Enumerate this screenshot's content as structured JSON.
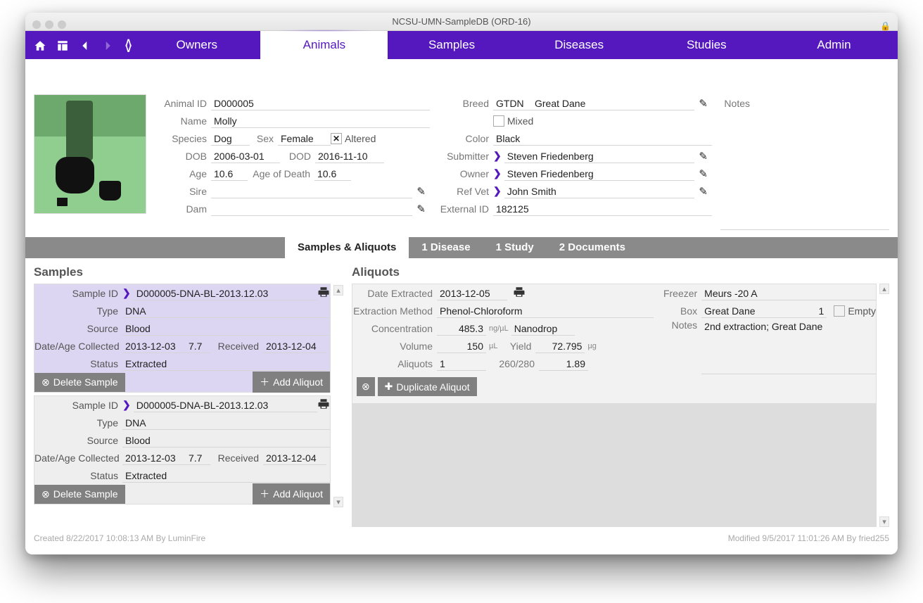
{
  "window": {
    "title": "NCSU-UMN-SampleDB (ORD-16)"
  },
  "nav": {
    "tabs": [
      "Owners",
      "Animals",
      "Samples",
      "Diseases",
      "Studies",
      "Admin"
    ],
    "active": "Animals"
  },
  "animal": {
    "id_label": "Animal ID",
    "id": "D000005",
    "name_label": "Name",
    "name": "Molly",
    "species_label": "Species",
    "species": "Dog",
    "sex_label": "Sex",
    "sex": "Female",
    "altered_label": "Altered",
    "altered": true,
    "dob_label": "DOB",
    "dob": "2006-03-01",
    "dod_label": "DOD",
    "dod": "2016-11-10",
    "age_label": "Age",
    "age": "10.6",
    "age_death_label": "Age of Death",
    "age_death": "10.6",
    "sire_label": "Sire",
    "sire": "",
    "dam_label": "Dam",
    "dam": "",
    "breed_label": "Breed",
    "breed_code": "GTDN",
    "breed_name": "Great Dane",
    "mixed_label": "Mixed",
    "mixed": false,
    "color_label": "Color",
    "color": "Black",
    "submitter_label": "Submitter",
    "submitter": "Steven Friedenberg",
    "owner_label": "Owner",
    "owner": "Steven Friedenberg",
    "refvet_label": "Ref Vet",
    "refvet": "John Smith",
    "externalid_label": "External ID",
    "externalid": "182125",
    "notes_label": "Notes"
  },
  "subtabs": {
    "items": [
      "Samples & Aliquots",
      "1 Disease",
      "1 Study",
      "2 Documents"
    ],
    "active": "Samples & Aliquots"
  },
  "samples": {
    "heading": "Samples",
    "labels": {
      "sample_id": "Sample ID",
      "type": "Type",
      "source": "Source",
      "dateage": "Date/Age Collected",
      "received_lbl": "Received",
      "status": "Status"
    },
    "btn_delete": "Delete Sample",
    "btn_add": "Add Aliquot",
    "items": [
      {
        "id": "D000005-DNA-BL-2013.12.03",
        "type": "DNA",
        "source": "Blood",
        "collected": "2013-12-03",
        "age": "7.7",
        "received": "2013-12-04",
        "status": "Extracted",
        "selected": true
      },
      {
        "id": "D000005-DNA-BL-2013.12.03",
        "type": "DNA",
        "source": "Blood",
        "collected": "2013-12-03",
        "age": "7.7",
        "received": "2013-12-04",
        "status": "Extracted",
        "selected": false
      }
    ]
  },
  "aliquots": {
    "heading": "Aliquots",
    "labels": {
      "date_extracted": "Date Extracted",
      "extraction_method": "Extraction Method",
      "concentration": "Concentration",
      "conc_unit": "ng/µL",
      "volume": "Volume",
      "vol_unit": "µL",
      "yield": "Yield",
      "yield_unit": "µg",
      "aliquots": "Aliquots",
      "ratio": "260/280",
      "freezer": "Freezer",
      "box": "Box",
      "empty": "Empty",
      "notes": "Notes"
    },
    "btn_dup": "Duplicate Aliquot",
    "item": {
      "date_extracted": "2013-12-05",
      "extraction_method": "Phenol-Chloroform",
      "concentration": "485.3",
      "conc_method": "Nanodrop",
      "volume": "150",
      "yield": "72.795",
      "aliquots": "1",
      "ratio": "1.89",
      "freezer": "Meurs -20 A",
      "box": "Great Dane",
      "box_num": "1",
      "empty": false,
      "notes": "2nd extraction; Great Dane"
    }
  },
  "footer": {
    "created": "Created 8/22/2017 10:08:13 AM By LuminFire",
    "modified": "Modified 9/5/2017 11:01:26 AM By fried255"
  }
}
